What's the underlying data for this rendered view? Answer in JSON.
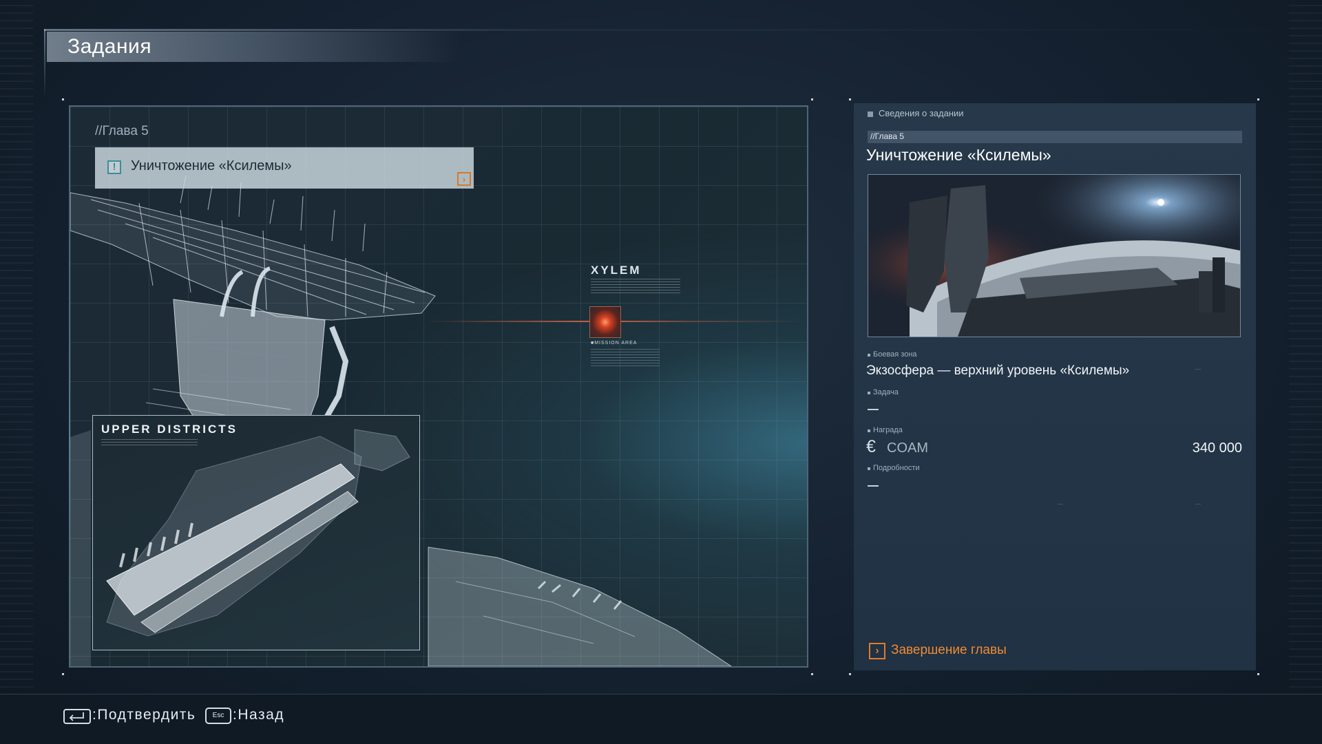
{
  "header": {
    "title": "Задания"
  },
  "map": {
    "chapter_label": "//Глава 5",
    "selected_mission": "Уничтожение «Ксилемы»",
    "location_label": "XYLEM",
    "location_area_text": "■MISSION AREA",
    "inset_title": "UPPER DISTRICTS",
    "icons": {
      "alert": "exclamation-icon",
      "arrow": "chevron-right-icon"
    }
  },
  "info": {
    "section_header": "Сведения о задании",
    "chapter": "//Глава 5",
    "title": "Уничтожение «Ксилемы»",
    "fields": {
      "zone_label": "Боевая зона",
      "zone_value": "Экзосфера — верхний уровень «Ксилемы»",
      "task_label": "Задача",
      "task_value": "—",
      "reward_label": "Награда",
      "reward_currency": "COAM",
      "reward_amount": "340 000",
      "details_label": "Подробности",
      "details_value": "—"
    },
    "chapter_end_label": "Завершение главы"
  },
  "footer": {
    "confirm_label": ":Подтвердить",
    "esc_key": "Esc",
    "back_label": ":Назад"
  },
  "colors": {
    "accent_orange": "#f08b35",
    "alert_teal": "#3a8f97",
    "marker_red": "#d23f20"
  }
}
